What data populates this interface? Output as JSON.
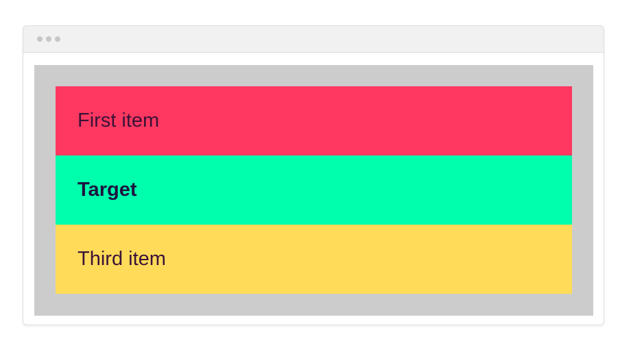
{
  "window": {
    "titlebar_dots": 3
  },
  "list": {
    "items": [
      {
        "label": "First item",
        "color": "#ff3861"
      },
      {
        "label": "Target",
        "color": "#00ffac"
      },
      {
        "label": "Third item",
        "color": "#ffdb59"
      }
    ]
  },
  "colors": {
    "viewport_background": "#cccccc",
    "text": "#3b1238"
  }
}
